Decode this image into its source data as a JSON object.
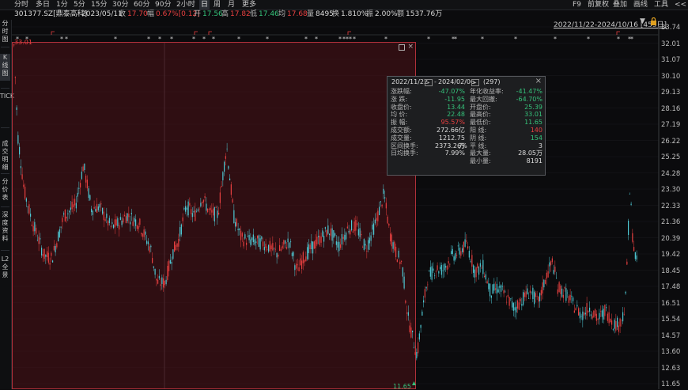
{
  "timeframes": [
    "分时",
    "多日",
    "1分",
    "5分",
    "15分",
    "30分",
    "60分",
    "90分",
    "2小时",
    "日",
    "周",
    "月",
    "更多"
  ],
  "active_timeframe": "日",
  "tools": [
    "F9",
    "前复权",
    "叠加",
    "画线",
    "工具",
    "<<"
  ],
  "info": {
    "code": "301377.SZ[鼎泰高科]",
    "date": "2023/05/11",
    "close_label": "收",
    "close": "17.70",
    "amp_label": "幅",
    "amp": "0.67%[0.12]",
    "open_label": "开",
    "open": "17.56",
    "high_label": "高",
    "high": "17.82",
    "low_label": "低",
    "low": "17.46",
    "avg_label": "均",
    "avg": "17.68",
    "vol_label": "量",
    "vol": "8495",
    "turn_label": "换",
    "turn": "1.810%",
    "swing_label": "振",
    "swing": "2.00%",
    "amount_label": "额",
    "amount": "1537.76万"
  },
  "sidebar": [
    {
      "label": "分时图"
    },
    {
      "label": "K线图"
    },
    {
      "label": "TICK"
    },
    {
      "label": "成交明细"
    },
    {
      "label": "分价表"
    },
    {
      "label": "深度资料"
    },
    {
      "label": "L2全景"
    }
  ],
  "date_range": "2022/11/22-2024/10/16 [459日]",
  "y_axis": [
    "33.74",
    "32.01",
    "31.07",
    "30.10",
    "29.13",
    "28.16",
    "27.19",
    "26.22",
    "25.25",
    "24.28",
    "23.30",
    "22.33",
    "21.36",
    "20.39",
    "19.42",
    "18.45",
    "17.48",
    "16.51",
    "15.54",
    "14.57",
    "13.60",
    "12.63",
    "11.65"
  ],
  "low_marker": "11.65",
  "high_marker": "33.01",
  "popup": {
    "start": "2022/11/22",
    "end": "2024/02/06",
    "count": "(297)",
    "left": [
      {
        "k": "涨跌幅:",
        "v": "-47.07%",
        "c": "neg"
      },
      {
        "k": "涨 跌:",
        "v": "-11.95",
        "c": "neg"
      },
      {
        "k": "收盘价:",
        "v": "13.44",
        "c": "neg"
      },
      {
        "k": "均 价:",
        "v": "22.48",
        "c": "neg"
      },
      {
        "k": "振 幅:",
        "v": "95.57%",
        "c": "pos"
      },
      {
        "k": "成交额:",
        "v": "272.66亿",
        "c": "wht"
      },
      {
        "k": "成交量:",
        "v": "1212.75万",
        "c": "wht"
      },
      {
        "k": "区间换手:",
        "v": "2373.26%",
        "c": "wht"
      },
      {
        "k": "日均换手:",
        "v": "7.99%",
        "c": "wht"
      }
    ],
    "right": [
      {
        "k": "年化收益率:",
        "v": "-41.47%",
        "c": "neg"
      },
      {
        "k": "最大回撤:",
        "v": "-64.70%",
        "c": "neg"
      },
      {
        "k": "开盘价:",
        "v": "25.39",
        "c": "neg"
      },
      {
        "k": "最高价:",
        "v": "33.01",
        "c": "neg"
      },
      {
        "k": "最低价:",
        "v": "11.65",
        "c": "neg"
      },
      {
        "k": "阳 线:",
        "v": "140",
        "c": "pos"
      },
      {
        "k": "阴 线:",
        "v": "154",
        "c": "neg"
      },
      {
        "k": "平 线:",
        "v": "3",
        "c": "wht"
      },
      {
        "k": "最大量:",
        "v": "28.05万",
        "c": "wht"
      },
      {
        "k": "最小量:",
        "v": "8191",
        "c": "wht"
      }
    ]
  },
  "colors": {
    "up": "#e84040",
    "down": "#4ec9d4",
    "bg": "#0b0b0d"
  }
}
